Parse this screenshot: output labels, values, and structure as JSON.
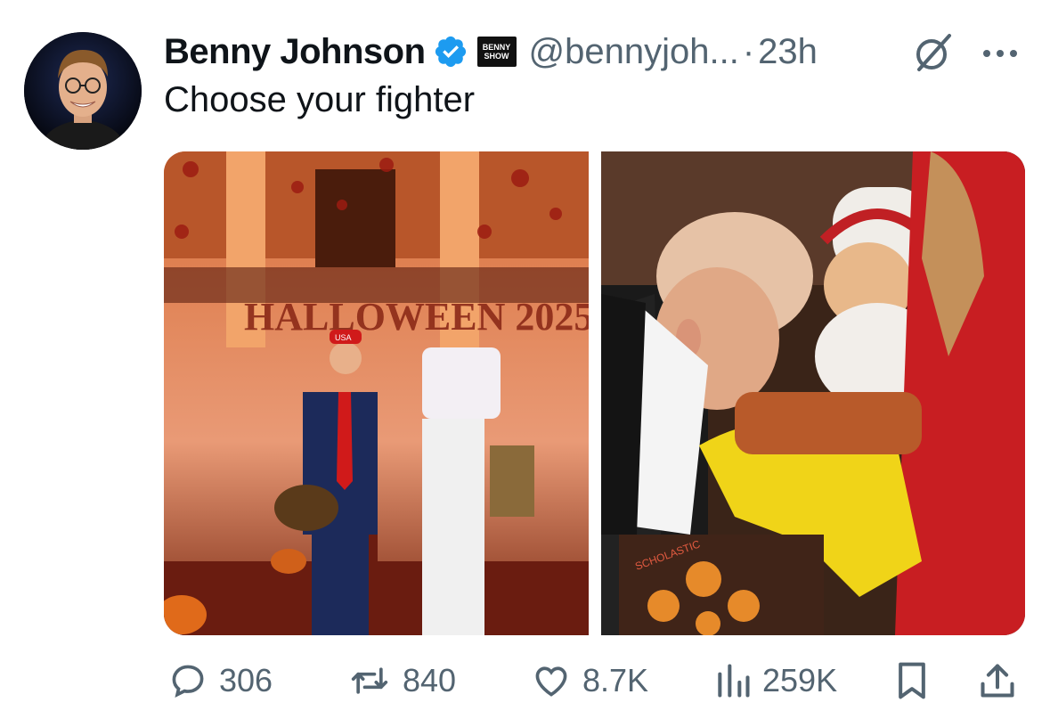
{
  "tweet": {
    "author_name": "Benny Johnson",
    "handle": "@bennyjoh...",
    "separator": "·",
    "time": "23h",
    "badge_text_line1": "BENNY",
    "badge_text_line2": "SHOW",
    "text": "Choose your fighter",
    "media": [
      {
        "overlay_text": "HALLOWEEN 2025",
        "hat_text": "USA"
      },
      {
        "overlay_text": "SCHOLASTIC"
      }
    ]
  },
  "actions": {
    "replies": "306",
    "reposts": "840",
    "likes": "8.7K",
    "views": "259K"
  },
  "colors": {
    "verified": "#1d9bf0",
    "muted": "#536471",
    "text": "#0f1419"
  },
  "icons": {
    "verified": "verified-badge-icon",
    "grok": "grok-icon",
    "more": "more-icon",
    "reply": "reply-icon",
    "repost": "repost-icon",
    "like": "heart-icon",
    "views": "views-icon",
    "bookmark": "bookmark-icon",
    "share": "share-icon"
  }
}
